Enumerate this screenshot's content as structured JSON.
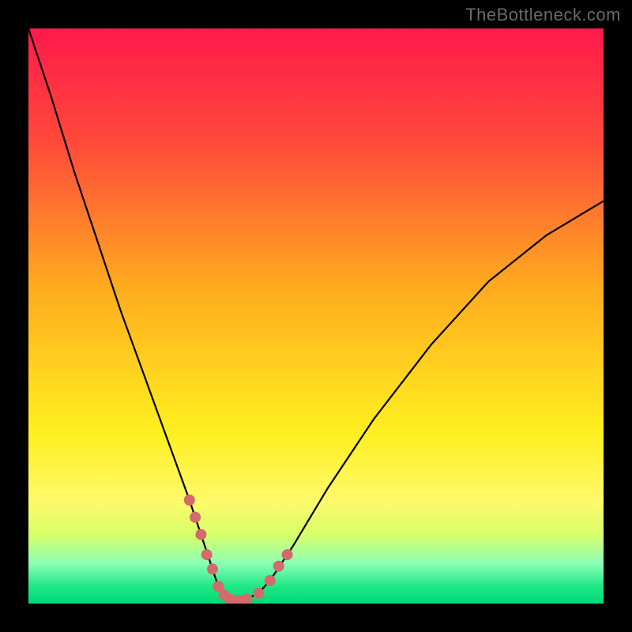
{
  "watermark": "TheBottleneck.com",
  "chart_data": {
    "type": "line",
    "title": "",
    "xlabel": "",
    "ylabel": "",
    "xlim": [
      0,
      100
    ],
    "ylim": [
      0,
      100
    ],
    "grid": false,
    "legend": false,
    "background_gradient": {
      "stops": [
        {
          "pos": 0.0,
          "color": "#ff1a4b"
        },
        {
          "pos": 0.2,
          "color": "#ff4a3a"
        },
        {
          "pos": 0.45,
          "color": "#ffab1f"
        },
        {
          "pos": 0.7,
          "color": "#ffef1f"
        },
        {
          "pos": 0.82,
          "color": "#fff96a"
        },
        {
          "pos": 0.88,
          "color": "#d8ff6a"
        },
        {
          "pos": 0.93,
          "color": "#8cffb7"
        },
        {
          "pos": 0.97,
          "color": "#20e887"
        },
        {
          "pos": 1.0,
          "color": "#00d879"
        }
      ]
    },
    "series": [
      {
        "name": "curve",
        "color": "#000000",
        "x": [
          0,
          4,
          8,
          12,
          16,
          20,
          24,
          28,
          30,
          32,
          33,
          34,
          35,
          36,
          37,
          38,
          40,
          42,
          46,
          52,
          60,
          70,
          80,
          90,
          100
        ],
        "y": [
          100,
          88,
          75,
          63,
          51,
          40,
          29,
          18,
          12,
          6,
          3,
          1.5,
          0.8,
          0.5,
          0.5,
          0.8,
          1.8,
          4,
          10,
          20,
          32,
          45,
          56,
          64,
          70
        ]
      }
    ],
    "markers": {
      "name": "threshold-dots",
      "color": "#d46a6a",
      "radius": 7,
      "points": [
        {
          "x": 28,
          "y": 18
        },
        {
          "x": 29,
          "y": 15
        },
        {
          "x": 30,
          "y": 12
        },
        {
          "x": 31,
          "y": 8.5
        },
        {
          "x": 32,
          "y": 6
        },
        {
          "x": 33,
          "y": 3
        },
        {
          "x": 34,
          "y": 1.5
        },
        {
          "x": 35,
          "y": 0.8
        },
        {
          "x": 36,
          "y": 0.5
        },
        {
          "x": 37,
          "y": 0.5
        },
        {
          "x": 38,
          "y": 0.8
        },
        {
          "x": 40,
          "y": 1.8
        },
        {
          "x": 42,
          "y": 4
        },
        {
          "x": 43.5,
          "y": 6.5
        },
        {
          "x": 45,
          "y": 8.5
        }
      ]
    }
  }
}
